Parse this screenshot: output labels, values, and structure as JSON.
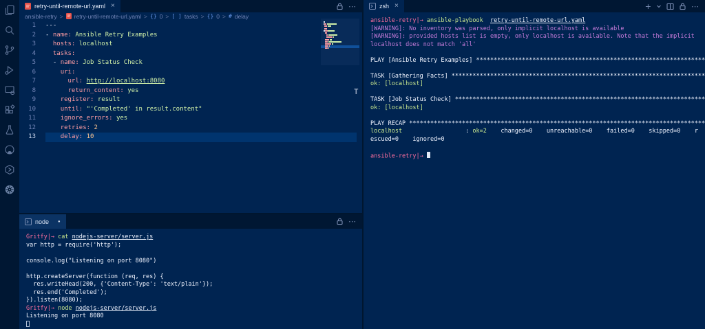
{
  "colors": {
    "background": "#002451",
    "bars": "#001733",
    "line_highlight": "#00346e",
    "dim_blue": "#7285b7",
    "key_pink": "#ff9da4",
    "string_green": "#d1f1a9",
    "number_orange": "#ffc58f",
    "warning_purple": "#c57bd9",
    "prompt_pink": "#ff6f9f",
    "yaml_icon_red": "#e5534b"
  },
  "activity_bar": {
    "icons": [
      "explorer",
      "search",
      "source-control",
      "run-and-debug",
      "remote-explorer",
      "extensions",
      "testing",
      "github",
      "hexagon-extension",
      "kubernetes"
    ]
  },
  "editor": {
    "tab": {
      "label": "retry-until-remote-url.yaml",
      "close_label": "×"
    },
    "actions": {
      "more_label": "⋯"
    },
    "breadcrumb": [
      {
        "t": "ansible-retry"
      },
      {
        "sep": true
      },
      {
        "icon": "yaml"
      },
      {
        "t": "retry-until-remote-url.yaml"
      },
      {
        "sep": true
      },
      {
        "sym": "{}"
      },
      {
        "t": "0"
      },
      {
        "sep": true
      },
      {
        "sym": "[ ]"
      },
      {
        "t": "tasks"
      },
      {
        "sep": true
      },
      {
        "sym": "{}"
      },
      {
        "t": "0"
      },
      {
        "sep": true
      },
      {
        "sym": "#"
      },
      {
        "t": "delay"
      }
    ],
    "breadcrumb_sep": ">",
    "active_line": 13,
    "lines": [
      {
        "n": 1,
        "seg": [
          [
            "w",
            "---"
          ]
        ]
      },
      {
        "n": 2,
        "seg": [
          [
            "w",
            "- "
          ],
          [
            "k",
            "name:"
          ],
          [
            "w",
            " "
          ],
          [
            "s",
            "Ansible Retry Examples"
          ]
        ]
      },
      {
        "n": 3,
        "seg": [
          [
            "w",
            "  "
          ],
          [
            "k",
            "hosts:"
          ],
          [
            "w",
            " "
          ],
          [
            "s",
            "localhost"
          ]
        ]
      },
      {
        "n": 4,
        "seg": [
          [
            "w",
            "  "
          ],
          [
            "k",
            "tasks:"
          ]
        ]
      },
      {
        "n": 5,
        "seg": [
          [
            "w",
            "  - "
          ],
          [
            "k",
            "name:"
          ],
          [
            "w",
            " "
          ],
          [
            "s",
            "Job Status Check"
          ]
        ]
      },
      {
        "n": 6,
        "seg": [
          [
            "w",
            "    "
          ],
          [
            "k",
            "uri:"
          ]
        ]
      },
      {
        "n": 7,
        "seg": [
          [
            "w",
            "      "
          ],
          [
            "k",
            "url:"
          ],
          [
            "w",
            " "
          ],
          [
            "lk",
            "http://localhost:8080"
          ]
        ]
      },
      {
        "n": 8,
        "seg": [
          [
            "w",
            "      "
          ],
          [
            "k",
            "return_content:"
          ],
          [
            "w",
            " "
          ],
          [
            "s",
            "yes"
          ]
        ]
      },
      {
        "n": 9,
        "seg": [
          [
            "w",
            "    "
          ],
          [
            "k",
            "register:"
          ],
          [
            "w",
            " "
          ],
          [
            "s",
            "result"
          ]
        ]
      },
      {
        "n": 10,
        "seg": [
          [
            "w",
            "    "
          ],
          [
            "k",
            "until:"
          ],
          [
            "w",
            " "
          ],
          [
            "s",
            "\"'Completed' in result.content\""
          ]
        ]
      },
      {
        "n": 11,
        "seg": [
          [
            "w",
            "    "
          ],
          [
            "k",
            "ignore_errors:"
          ],
          [
            "w",
            " "
          ],
          [
            "s",
            "yes"
          ]
        ]
      },
      {
        "n": 12,
        "seg": [
          [
            "w",
            "    "
          ],
          [
            "k",
            "retries:"
          ],
          [
            "w",
            " "
          ],
          [
            "n",
            "2"
          ]
        ]
      },
      {
        "n": 13,
        "seg": [
          [
            "w",
            "    "
          ],
          [
            "k",
            "delay:"
          ],
          [
            "w",
            " "
          ],
          [
            "n",
            "10"
          ]
        ]
      }
    ]
  },
  "zsh_panel": {
    "tab": {
      "label": "zsh",
      "close_label": "×"
    },
    "actions": {
      "new_label": "+",
      "more_label": "⋯"
    },
    "lines": [
      [
        [
          "pr",
          "ansible-retry|→"
        ],
        [
          "w",
          " "
        ],
        [
          "cmd",
          "ansible-playbook"
        ],
        [
          "w",
          "  "
        ],
        [
          "pa",
          "retry-until-remote-url.yaml"
        ]
      ],
      [
        [
          "warn",
          "[WARNING]: No inventory was parsed, only implicit localhost is available"
        ]
      ],
      [
        [
          "warn",
          "[WARNING]: provided hosts list is empty, only localhost is available. Note that the implicit"
        ]
      ],
      [
        [
          "warn",
          "localhost does not match 'all'"
        ]
      ],
      [],
      [
        [
          "w",
          "PLAY [Ansible Retry Examples] *****************************************************************"
        ]
      ],
      [],
      [
        [
          "w",
          "TASK [Gathering Facts] ************************************************************************"
        ]
      ],
      [
        [
          "ok",
          "ok: [localhost]"
        ]
      ],
      [],
      [
        [
          "w",
          "TASK [Job Status Check] ***********************************************************************"
        ]
      ],
      [
        [
          "ok",
          "ok: [localhost]"
        ]
      ],
      [],
      [
        [
          "w",
          "PLAY RECAP ************************************************************************************"
        ]
      ],
      [
        [
          "ok",
          "localhost"
        ],
        [
          "w",
          "                  : "
        ],
        [
          "ok",
          "ok=2"
        ],
        [
          "w",
          "    changed=0    unreachable=0    failed=0    skipped=0    r"
        ]
      ],
      [
        [
          "w",
          "escued=0    ignored=0"
        ]
      ],
      [],
      [
        [
          "pr",
          "ansible-retry|→"
        ],
        [
          "w",
          " "
        ],
        [
          "cb",
          ""
        ]
      ]
    ]
  },
  "node_panel": {
    "tab": {
      "label": "node",
      "dirty_dot": "●"
    },
    "lines": [
      [
        [
          "pr",
          "Gritfy|→"
        ],
        [
          "w",
          " "
        ],
        [
          "cmd",
          "cat"
        ],
        [
          "w",
          " "
        ],
        [
          "pa",
          "nodejs-server/server.js"
        ]
      ],
      [
        [
          "w",
          "var http = require('http');"
        ]
      ],
      [],
      [
        [
          "w",
          "console.log(\"Listening on port 8080\")"
        ]
      ],
      [],
      [
        [
          "w",
          "http.createServer(function (req, res) {"
        ]
      ],
      [
        [
          "w",
          "  res.writeHead(200, {'Content-Type': 'text/plain'});"
        ]
      ],
      [
        [
          "w",
          "  res.end('Completed');"
        ]
      ],
      [
        [
          "w",
          "}).listen(8080);"
        ]
      ],
      [
        [
          "pr",
          "Gritfy|→"
        ],
        [
          "w",
          " "
        ],
        [
          "cmd",
          "node"
        ],
        [
          "w",
          " "
        ],
        [
          "pa",
          "nodejs-server/server.js"
        ]
      ],
      [
        [
          "w",
          "Listening on port 8080"
        ]
      ],
      [
        [
          "ch",
          ""
        ]
      ]
    ]
  }
}
